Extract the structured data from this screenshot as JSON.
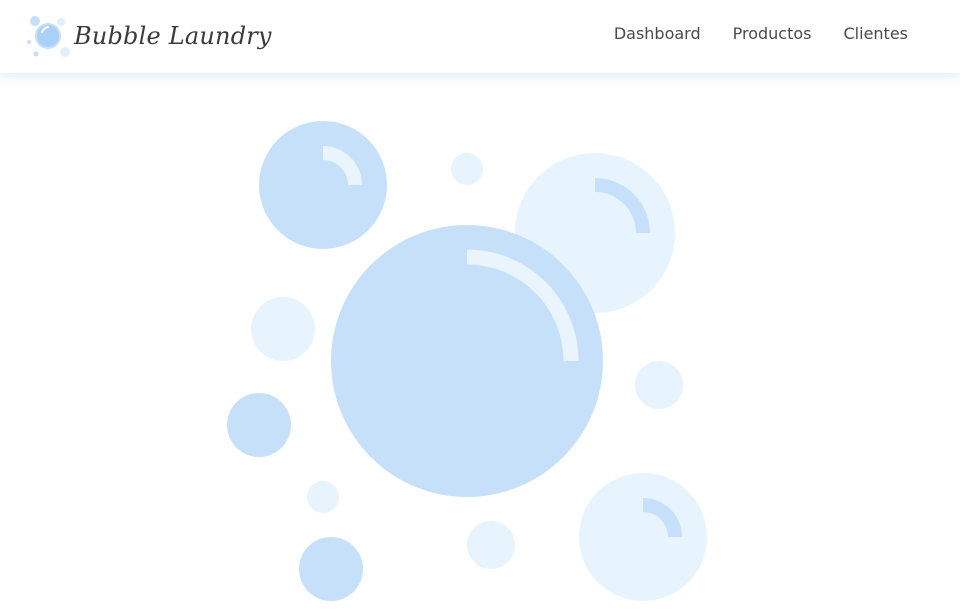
{
  "brand": {
    "name": "Bubble Laundry"
  },
  "nav": {
    "items": [
      "Dashboard",
      "Productos",
      "Clientes"
    ]
  },
  "colors": {
    "bubble_blue": "#c6e0fa",
    "bubble_light": "#e7f4fd",
    "shine": "#e9f4fd",
    "text": "#4a4a4a"
  },
  "icons": {
    "logo": "bubbles-logo-icon"
  }
}
